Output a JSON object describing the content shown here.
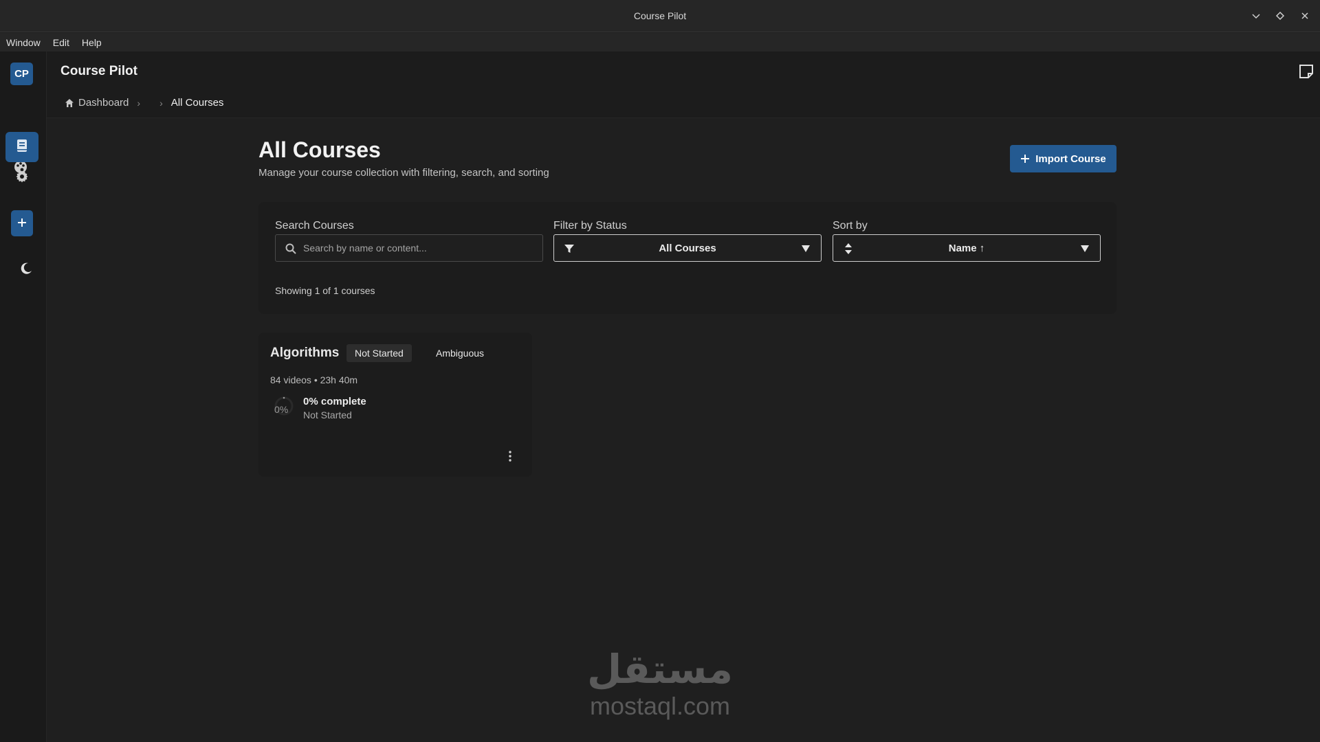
{
  "window": {
    "title": "Course Pilot"
  },
  "menu": [
    "Window",
    "Edit",
    "Help"
  ],
  "sidebar": {
    "logo": "CP"
  },
  "header": {
    "app_title": "Course Pilot"
  },
  "breadcrumb": {
    "home": "Dashboard",
    "current": "All Courses"
  },
  "main": {
    "title": "All Courses",
    "subtitle": "Manage your course collection with filtering, search, and sorting",
    "import_button": "Import Course"
  },
  "filters": {
    "search_label": "Search Courses",
    "search_placeholder": "Search by name or content...",
    "status_label": "Filter by Status",
    "status_value": "All Courses",
    "sort_label": "Sort by",
    "sort_value": "Name ↑",
    "count_text": "Showing 1 of 1 courses"
  },
  "courses": [
    {
      "name": "Algorithms",
      "status_badge": "Not Started",
      "tag_badge": "Ambiguous",
      "meta": "84 videos • 23h 40m",
      "progress_pct": "0%",
      "progress_value": 0,
      "progress_label": "0% complete",
      "progress_status": "Not Started"
    }
  ],
  "watermark": {
    "logo_text": "مستقل",
    "text": "mostaql.com"
  },
  "colors": {
    "accent": "#245a91",
    "background": "#1f1f1f"
  }
}
